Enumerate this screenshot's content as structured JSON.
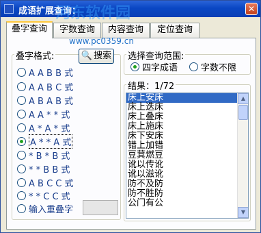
{
  "window": {
    "title": "成语扩展查询："
  },
  "watermark": "河东软件园",
  "url": "www.pc0359.cn",
  "tabs": [
    {
      "label": "叠字查询",
      "active": true
    },
    {
      "label": "字数查询",
      "active": false
    },
    {
      "label": "内容查询",
      "active": false
    },
    {
      "label": "定位查询",
      "active": false
    }
  ],
  "pattern_group": {
    "label": "叠字格式:"
  },
  "search_button": {
    "label": "搜索"
  },
  "patterns": [
    {
      "label": "A A B B 式",
      "selected": false
    },
    {
      "label": "A A B C 式",
      "selected": false
    },
    {
      "label": "A B A B 式",
      "selected": false
    },
    {
      "label": "A A * * 式",
      "selected": false
    },
    {
      "label": "A * A * 式",
      "selected": false
    },
    {
      "label": "A * * A 式",
      "selected": true
    },
    {
      "label": "* B * B 式",
      "selected": false
    },
    {
      "label": "* * B B 式",
      "selected": false
    },
    {
      "label": "A B C C 式",
      "selected": false
    },
    {
      "label": "* * C C 式",
      "selected": false
    },
    {
      "label": "输入重叠字",
      "selected": false
    }
  ],
  "custom_input": {
    "value": ""
  },
  "scope_group": {
    "label": "选择查询范围:"
  },
  "scope": [
    {
      "label": "四字成语",
      "selected": true
    },
    {
      "label": "字数不限",
      "selected": false
    }
  ],
  "results": {
    "label": "结果：1/72",
    "items": [
      "床上安床",
      "床上迭床",
      "床上叠床",
      "床上施床",
      "床下安床",
      "错上加错",
      "豆萁燃豆",
      "讹以传讹",
      "讹以滋讹",
      "防不及防",
      "防不胜防",
      "公门有公"
    ]
  }
}
